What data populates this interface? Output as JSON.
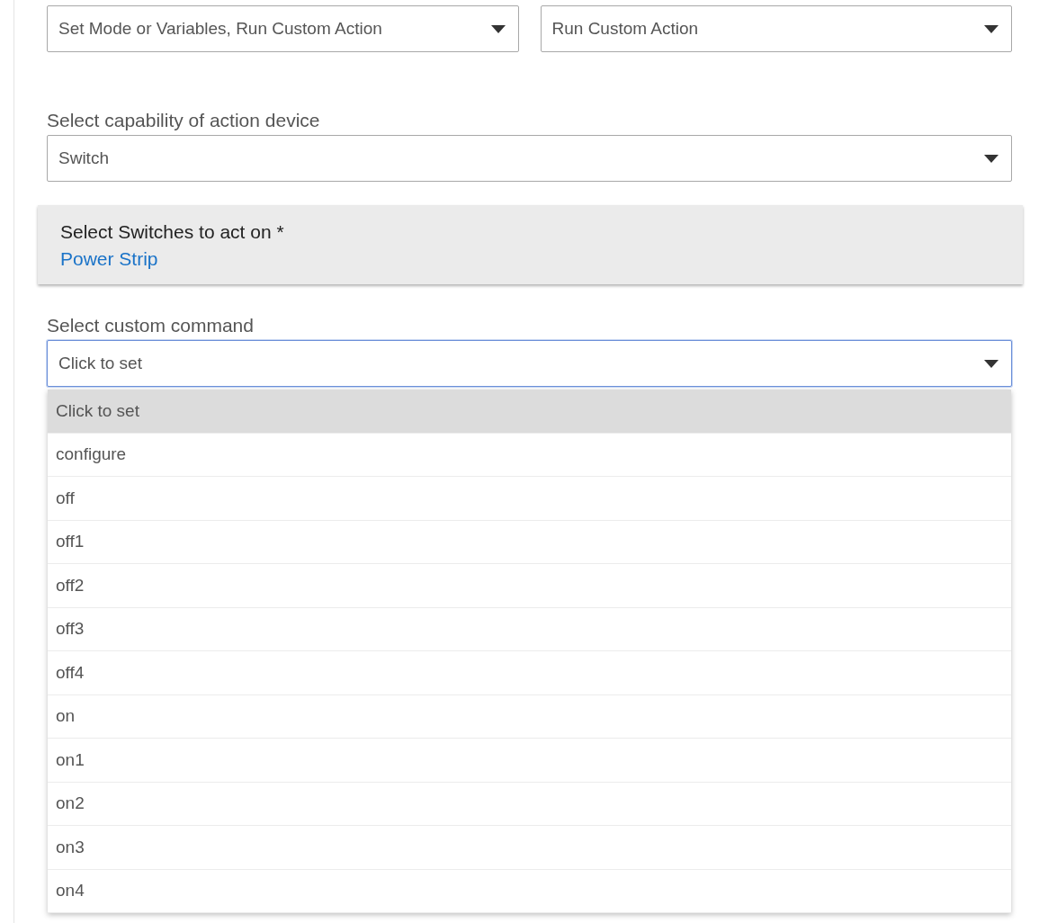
{
  "top_selects": [
    {
      "value": "Set Mode or Variables, Run Custom Action"
    },
    {
      "value": "Run Custom Action"
    }
  ],
  "capability": {
    "label": "Select capability of action device",
    "value": "Switch"
  },
  "device_card": {
    "title": "Select Switches to act on *",
    "link": "Power Strip"
  },
  "command": {
    "label": "Select custom command",
    "value": "Click to set",
    "focused": true,
    "options": [
      {
        "label": "Click to set",
        "selected": true
      },
      {
        "label": "configure",
        "selected": false
      },
      {
        "label": "off",
        "selected": false
      },
      {
        "label": "off1",
        "selected": false
      },
      {
        "label": "off2",
        "selected": false
      },
      {
        "label": "off3",
        "selected": false
      },
      {
        "label": "off4",
        "selected": false
      },
      {
        "label": "on",
        "selected": false
      },
      {
        "label": "on1",
        "selected": false
      },
      {
        "label": "on2",
        "selected": false
      },
      {
        "label": "on3",
        "selected": false
      },
      {
        "label": "on4",
        "selected": false
      }
    ]
  }
}
